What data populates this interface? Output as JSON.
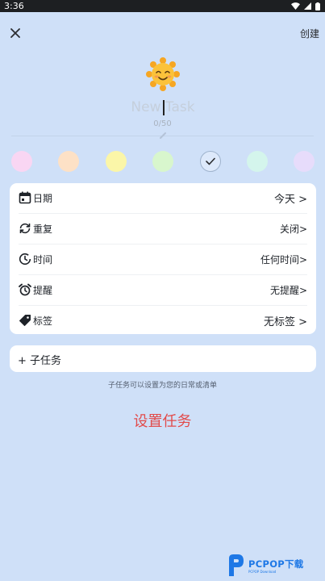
{
  "status_bar": {
    "time": "3:36"
  },
  "header": {
    "create_label": "创建"
  },
  "task": {
    "title_placeholder": "New Task",
    "counter": "0/50"
  },
  "colors": [
    {
      "name": "pink",
      "hex": "#f9d6f3"
    },
    {
      "name": "peach",
      "hex": "#fde1c6"
    },
    {
      "name": "yellow",
      "hex": "#fbf6a8"
    },
    {
      "name": "green",
      "hex": "#d8f6cd"
    },
    {
      "name": "blue-selected",
      "hex": "#dde9fb"
    },
    {
      "name": "mint",
      "hex": "#d4f5ec"
    },
    {
      "name": "lavender",
      "hex": "#e7dcfb"
    }
  ],
  "settings": [
    {
      "icon": "calendar-icon",
      "label": "日期",
      "value": "今天 >"
    },
    {
      "icon": "repeat-icon",
      "label": "重复",
      "value": "关闭>"
    },
    {
      "icon": "time-icon",
      "label": "时间",
      "value": "任何时间>"
    },
    {
      "icon": "alarm-icon",
      "label": "提醒",
      "value": "无提醒>"
    },
    {
      "icon": "tag-icon",
      "label": "标签",
      "value": "无标签 >"
    }
  ],
  "subtask": {
    "label": "+ 子任务"
  },
  "hint": "子任务可以设置为您的日常或清单",
  "set_task_label": "设置任务",
  "watermark": {
    "brand": "PCPOP下载",
    "sub": "PCPOP Download"
  },
  "accent_colors": {
    "set_task": "#e24a4a",
    "background": "#cfe0f8"
  }
}
